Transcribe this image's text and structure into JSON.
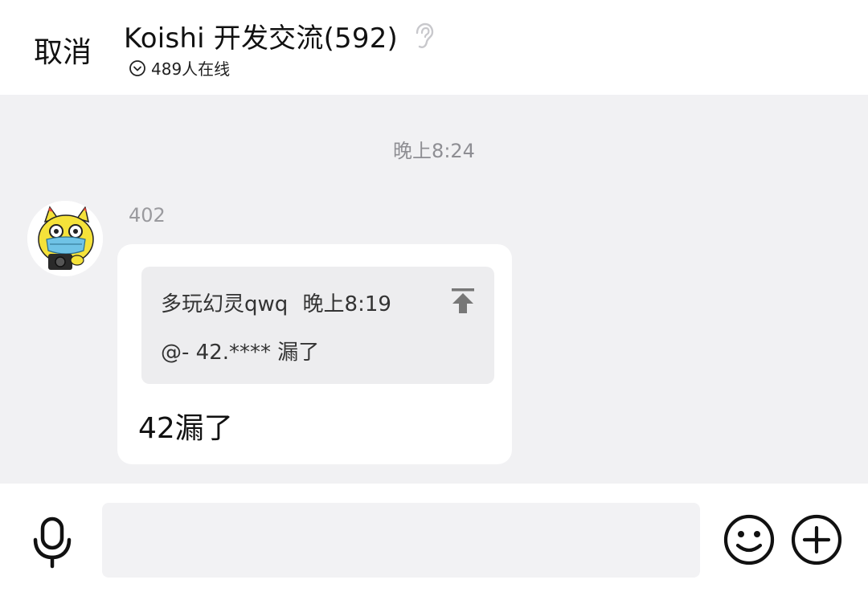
{
  "header": {
    "cancel_label": "取消",
    "title": "Koishi 开发交流(592)",
    "online": "489人在线",
    "icons": {
      "mute": "ear-icon",
      "expand": "chevron-down-circle-icon"
    }
  },
  "chat": {
    "timestamp": "晚上8:24",
    "messages": [
      {
        "sender": "402",
        "avatar": "cat-with-mask-avatar",
        "quote": {
          "author": "多玩幻灵qwq",
          "time": "晚上8:19",
          "text": "@- 42.**** 漏了",
          "icon": "jump-to-top-icon"
        },
        "text": "42漏了"
      }
    ]
  },
  "input": {
    "value": "",
    "placeholder": "",
    "icons": {
      "voice": "microphone-icon",
      "emoji": "smiley-icon",
      "more": "plus-circle-icon"
    }
  },
  "colors": {
    "background": "#f1f1f3",
    "header": "#ffffff",
    "bubble": "#ffffff",
    "quote": "#ededef",
    "muted_text": "#8e8e93",
    "avatar_yellow": "#f5e23a",
    "mask_blue": "#6fc3e6"
  }
}
